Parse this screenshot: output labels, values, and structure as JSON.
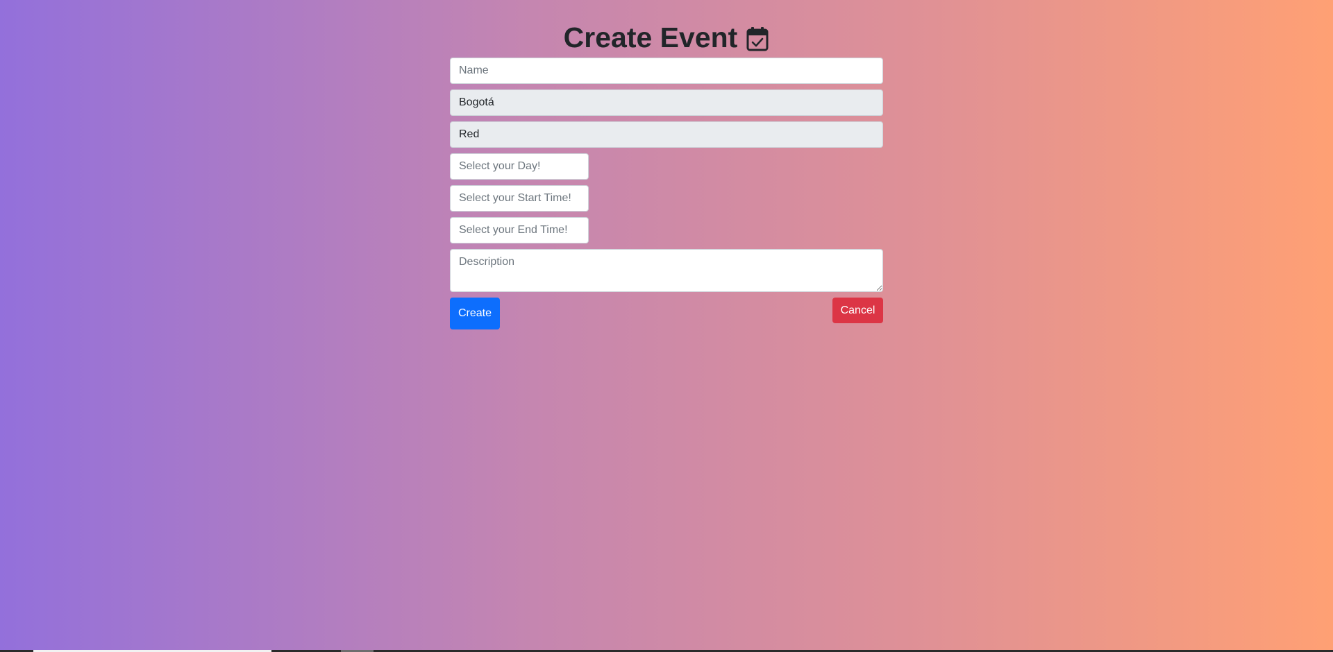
{
  "header": {
    "title": "Create Event",
    "icon": "calendar-check-icon"
  },
  "form": {
    "name": {
      "placeholder": "Name",
      "value": ""
    },
    "city": {
      "value": "Bogotá"
    },
    "color": {
      "value": "Red"
    },
    "day": {
      "placeholder": "Select your Day!"
    },
    "start_time": {
      "placeholder": "Select your Start Time!"
    },
    "end_time": {
      "placeholder": "Select your End Time!"
    },
    "description": {
      "placeholder": "Description"
    }
  },
  "buttons": {
    "create_label": "Create",
    "cancel_label": "Cancel"
  },
  "colors": {
    "primary": "#0d6efd",
    "danger": "#dc3545",
    "gradient_start": "#9370db",
    "gradient_end": "#ffa074"
  }
}
